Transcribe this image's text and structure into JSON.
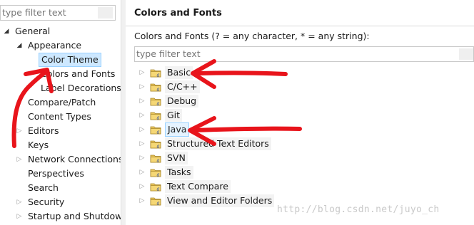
{
  "left_panel": {
    "filter_placeholder": "type filter text",
    "tree": [
      {
        "label": "General",
        "level": 0,
        "state": "expanded"
      },
      {
        "label": "Appearance",
        "level": 1,
        "state": "expanded"
      },
      {
        "label": "Color Theme",
        "level": 2,
        "state": "leaf",
        "selected": true
      },
      {
        "label": "Colors and Fonts",
        "level": 2,
        "state": "leaf"
      },
      {
        "label": "Label Decorations",
        "level": 2,
        "state": "leaf"
      },
      {
        "label": "Compare/Patch",
        "level": 1,
        "state": "leaf"
      },
      {
        "label": "Content Types",
        "level": 1,
        "state": "leaf"
      },
      {
        "label": "Editors",
        "level": 1,
        "state": "collapsed"
      },
      {
        "label": "Keys",
        "level": 1,
        "state": "leaf"
      },
      {
        "label": "Network Connections",
        "level": 1,
        "state": "collapsed"
      },
      {
        "label": "Perspectives",
        "level": 1,
        "state": "leaf"
      },
      {
        "label": "Search",
        "level": 1,
        "state": "leaf"
      },
      {
        "label": "Security",
        "level": 1,
        "state": "collapsed"
      },
      {
        "label": "Startup and Shutdown",
        "level": 1,
        "state": "collapsed"
      }
    ]
  },
  "right_panel": {
    "title": "Colors and Fonts",
    "description": "Colors and Fonts (? = any character, * = any string):",
    "filter_placeholder": "type filter text",
    "categories": [
      {
        "label": "Basic",
        "selected": false
      },
      {
        "label": "C/C++",
        "selected": false
      },
      {
        "label": "Debug",
        "selected": false
      },
      {
        "label": "Git",
        "selected": false
      },
      {
        "label": "Java",
        "selected": true
      },
      {
        "label": "Structured Text Editors",
        "selected": false
      },
      {
        "label": "SVN",
        "selected": false
      },
      {
        "label": "Tasks",
        "selected": false
      },
      {
        "label": "Text Compare",
        "selected": false
      },
      {
        "label": "View and Editor Folders",
        "selected": false
      }
    ]
  },
  "watermark": "http://blog.csdn.net/juyo_ch",
  "icons": {
    "folder": "folder-font-icon",
    "expand": "triangle-right-icon",
    "collapse": "triangle-down-icon"
  },
  "colors": {
    "annotation": "#e8141b",
    "selection_bg": "#cde8ff",
    "selection_border": "#99d1ff"
  }
}
